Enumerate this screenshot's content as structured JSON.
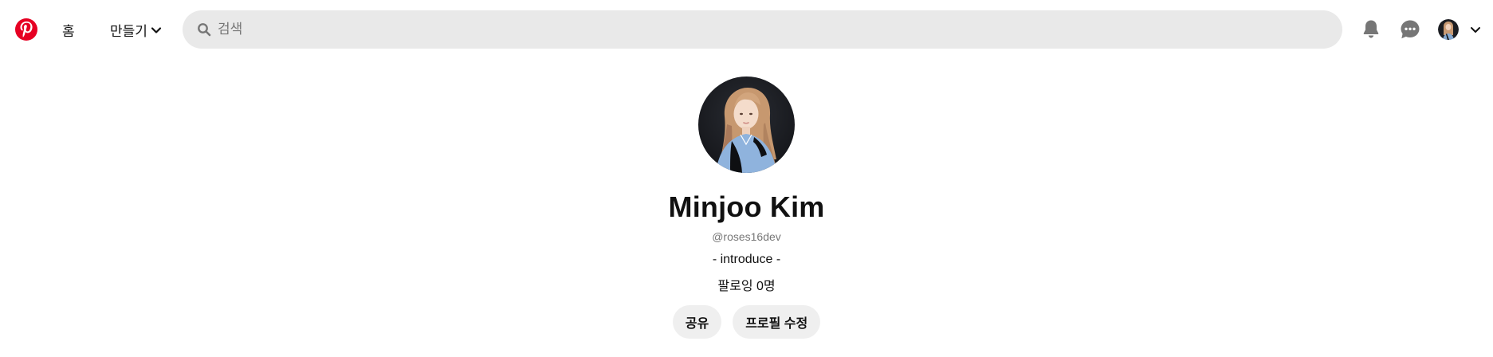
{
  "header": {
    "logo_icon": "pinterest-logo-icon",
    "brand_color": "#e60023",
    "nav": {
      "home_label": "홈",
      "create_label": "만들기"
    },
    "search": {
      "placeholder": "검색",
      "value": ""
    },
    "icons": {
      "search": "search-icon",
      "notifications": "bell-icon",
      "messages": "chat-bubble-icon",
      "account_menu": "chevron-down-icon"
    }
  },
  "profile": {
    "name": "Minjoo Kim",
    "handle": "@roses16dev",
    "about": "- introduce -",
    "following_text": "팔로잉 0명",
    "actions": {
      "share_label": "공유",
      "edit_label": "프로필 수정"
    }
  },
  "colors": {
    "search_bg": "#e9e9e9",
    "pill_bg": "#efefef",
    "muted_text": "#767676"
  }
}
